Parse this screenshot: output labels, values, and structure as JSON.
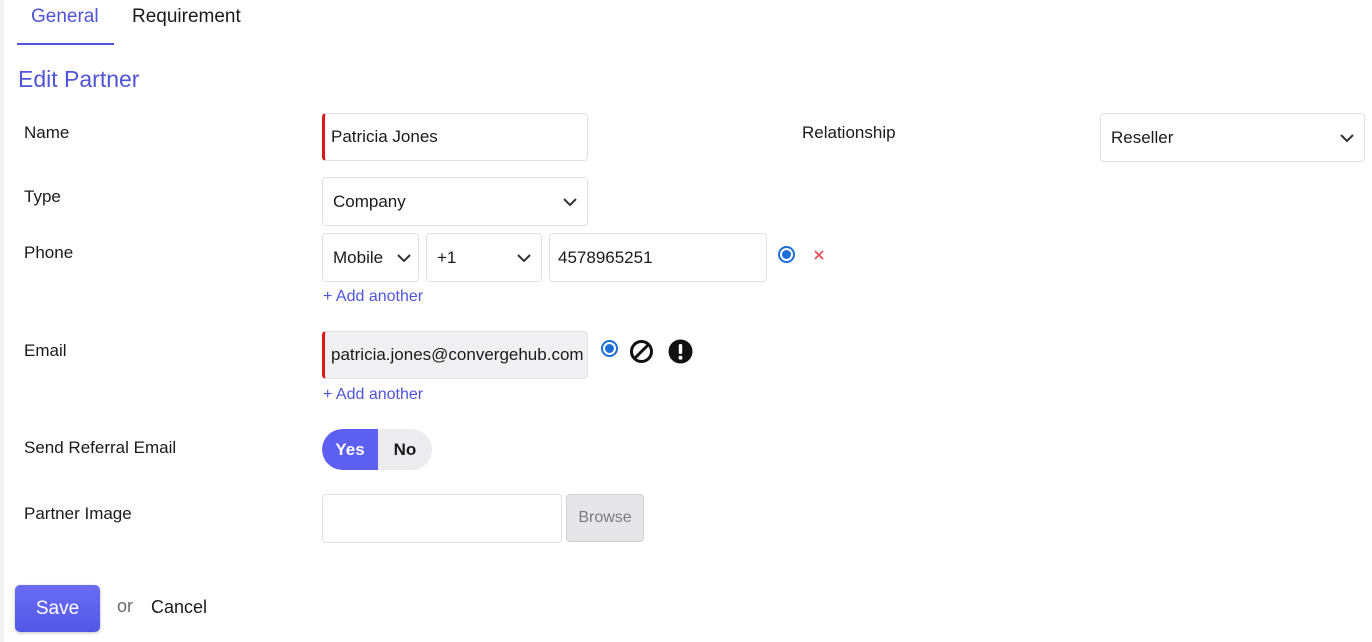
{
  "tabs": [
    {
      "label": "General",
      "active": true
    },
    {
      "label": "Requirement",
      "active": false
    }
  ],
  "page_title": "Edit Partner",
  "form": {
    "name": {
      "label": "Name",
      "value": "Patricia Jones"
    },
    "relationship": {
      "label": "Relationship",
      "value": "Reseller"
    },
    "type": {
      "label": "Type",
      "value": "Company"
    },
    "phone": {
      "label": "Phone",
      "kind": "Mobile",
      "country_code": "+1",
      "number": "4578965251",
      "add_another": "+ Add another"
    },
    "email": {
      "label": "Email",
      "value": "patricia.jones@convergehub.com",
      "add_another": "+ Add another"
    },
    "send_referral": {
      "label": "Send Referral Email",
      "yes": "Yes",
      "no": "No",
      "selected": "Yes"
    },
    "partner_image": {
      "label": "Partner Image",
      "browse": "Browse"
    }
  },
  "actions": {
    "save": "Save",
    "or": "or",
    "cancel": "Cancel"
  },
  "icons": {
    "select": "chevron-down-icon",
    "primary": "radio-selected-icon",
    "remove": "close-icon",
    "opt_out": "prohibited-icon",
    "invalid": "exclamation-circle-icon"
  },
  "colors": {
    "accent": "#4f55d6",
    "button": "#5c5ff0",
    "required": "#d91818",
    "radio": "#1d6fd6",
    "remove": "#e8505b"
  }
}
